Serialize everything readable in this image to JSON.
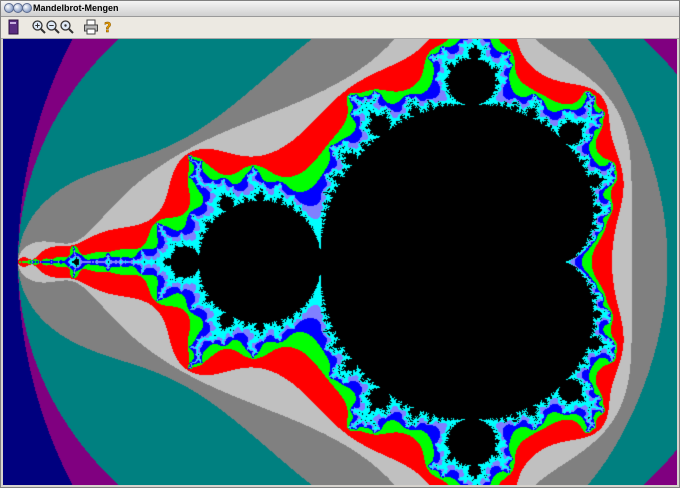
{
  "window": {
    "title": "Mandelbrot-Mengen"
  },
  "titlebar_buttons": [
    "close-icon",
    "minimize-icon",
    "maximize-icon"
  ],
  "toolbar": {
    "tools": [
      {
        "name": "book-icon"
      },
      {
        "name": "zoom-in-icon"
      },
      {
        "name": "zoom-out-icon"
      },
      {
        "name": "zoom-reset-icon"
      },
      {
        "name": "print-icon"
      },
      {
        "name": "help-icon"
      }
    ]
  },
  "fractal": {
    "type": "mandelbrot",
    "palette": {
      "outer": "#00007f",
      "band1": "#800080",
      "band2": "#008080",
      "band3": "#808080",
      "band4": "#c0c0c0",
      "band5": "#ff0000",
      "band6": "#00ff00",
      "band7": "#0000ff",
      "band8": "#8080ff",
      "band9": "#00ffff",
      "inside": "#000000"
    }
  }
}
